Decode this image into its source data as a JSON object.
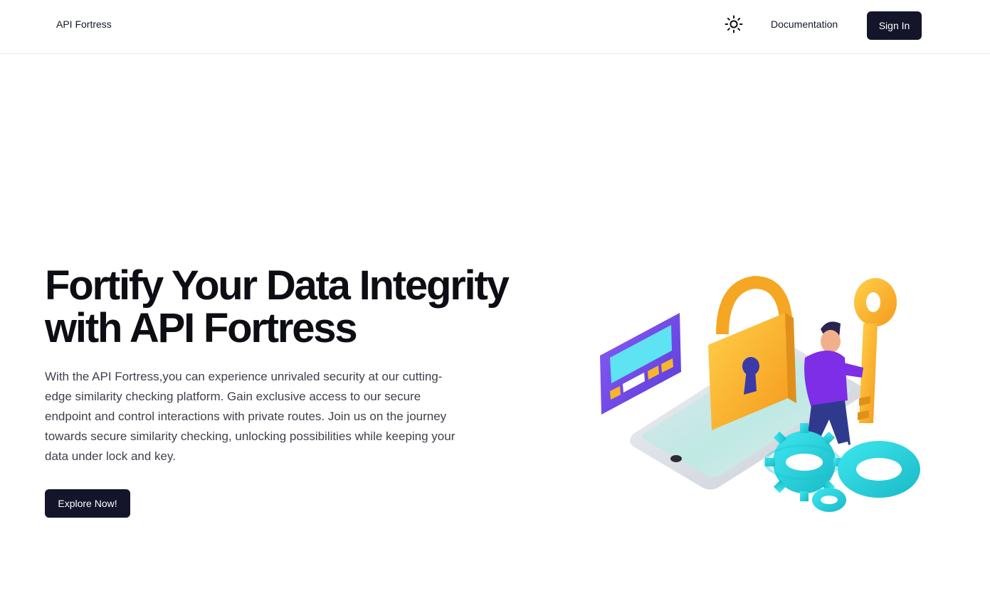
{
  "nav": {
    "brand": "API Fortress",
    "theme_icon": "sun-icon",
    "documentation": "Documentation",
    "sign_in": "Sign In"
  },
  "hero": {
    "title": "Fortify Your Data Integrity with API Fortress",
    "description": "With the API Fortress,you can experience unrivaled security at our cutting-edge similarity checking platform. Gain exclusive access to our secure endpoint and control interactions with private routes. Join us on the journey towards secure similarity checking, unlocking possibilities while keeping your data under lock and key.",
    "cta": "Explore Now!"
  },
  "colors": {
    "primary_button": "#14142b",
    "text_dark": "#0d0d14",
    "text_body": "#3f3f4a",
    "lock_gold": "#f7b52c",
    "gear_cyan": "#2fd9e6",
    "card_purple": "#7a4cf0"
  },
  "illustration": {
    "icon": "security-lock-illustration"
  }
}
